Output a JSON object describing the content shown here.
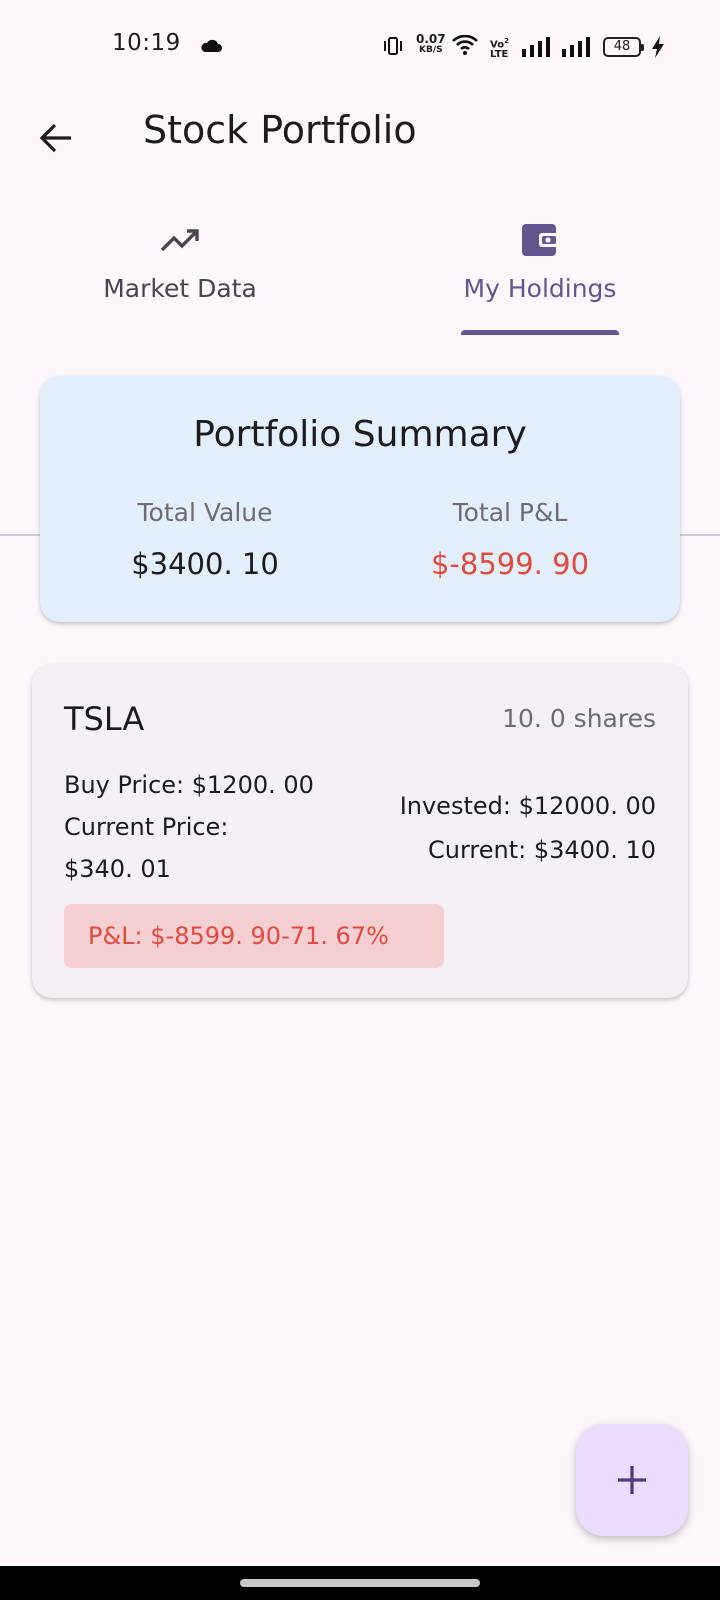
{
  "status_bar": {
    "time": "10:19",
    "net_speed_value": "0.07",
    "net_speed_unit": "KB/S",
    "volte_top": "Vo",
    "volte_bottom": "LTE",
    "volte_sim": "2",
    "battery": "48"
  },
  "app_bar": {
    "title": "Stock Portfolio",
    "back_icon": "arrow-left-icon"
  },
  "tabs": [
    {
      "label": "Market Data",
      "icon": "trending-up-icon",
      "selected": false
    },
    {
      "label": "My Holdings",
      "icon": "wallet-icon",
      "selected": true
    }
  ],
  "summary": {
    "title": "Portfolio Summary",
    "total_value_label": "Total Value",
    "total_value": "$3400. 10",
    "total_pnl_label": "Total P&L",
    "total_pnl": "$-8599. 90"
  },
  "holdings": [
    {
      "ticker": "TSLA",
      "shares": "10. 0 shares",
      "buy_price": "Buy Price: $1200. 00",
      "current_price_label": "Current Price:",
      "current_price_value": "$340. 01",
      "invested": "Invested: $12000. 00",
      "current": "Current: $3400. 10",
      "pnl": "P&L: $-8599. 90-71. 67%"
    }
  ],
  "fab": {
    "icon": "plus-icon"
  },
  "colors": {
    "primary": "#65558f",
    "negative": "#e04a3f",
    "summary_bg": "#e3f0fb",
    "card_bg": "#f4f0f5",
    "pnl_chip_bg": "#f6cfd3",
    "fab_bg": "#eaddff",
    "page_bg": "#fdf7fc"
  }
}
